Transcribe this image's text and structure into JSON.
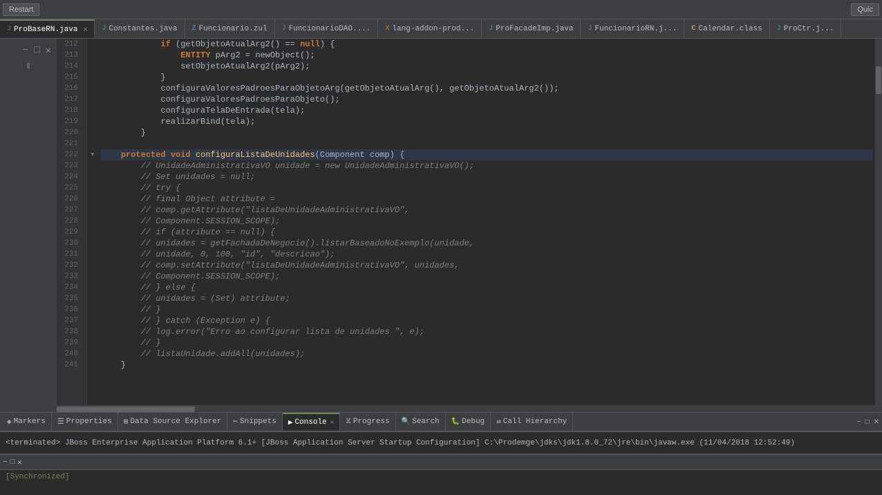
{
  "topbar": {
    "restart_label": "Restart",
    "quick_label": "Quic"
  },
  "tabs": [
    {
      "label": "ProBaseRN.java",
      "icon": "J",
      "type": "java",
      "active": true
    },
    {
      "label": "Constantes.java",
      "icon": "J",
      "type": "java",
      "active": false
    },
    {
      "label": "Funcionario.zul",
      "icon": "Z",
      "type": "zul",
      "active": false
    },
    {
      "label": "FuncionarioDAO....",
      "icon": "J",
      "type": "java",
      "active": false
    },
    {
      "label": "lang-addon-prod...",
      "icon": "X",
      "type": "xml",
      "active": false
    },
    {
      "label": "ProFacadeImp.java",
      "icon": "J",
      "type": "java",
      "active": false
    },
    {
      "label": "FuncionarioRN.j...",
      "icon": "J",
      "type": "java",
      "active": false
    },
    {
      "label": "Calendar.class",
      "icon": "C",
      "type": "class",
      "active": false
    },
    {
      "label": "ProCtr.j...",
      "icon": "J",
      "type": "java",
      "active": false
    }
  ],
  "lines": [
    {
      "num": 212,
      "content": "            if (getObjetoAtualArg2() == null) {",
      "fold": false,
      "highlighted": false
    },
    {
      "num": 213,
      "content": "                ENTITY pArg2 = newObject();",
      "fold": false,
      "highlighted": false
    },
    {
      "num": 214,
      "content": "                setObjetoAtualArg2(pArg2);",
      "fold": false,
      "highlighted": false
    },
    {
      "num": 215,
      "content": "            }",
      "fold": false,
      "highlighted": false
    },
    {
      "num": 216,
      "content": "            configuraValoresPadroesParaObjetoArg(getObjetoAtualArg(), getObjetoAtualArg2());",
      "fold": false,
      "highlighted": false
    },
    {
      "num": 217,
      "content": "            configuraValoresPadroesParaObjeto();",
      "fold": false,
      "highlighted": false
    },
    {
      "num": 218,
      "content": "            configuraTelaDeEntrada(tela);",
      "fold": false,
      "highlighted": false
    },
    {
      "num": 219,
      "content": "            realizarBind(tela);",
      "fold": false,
      "highlighted": false
    },
    {
      "num": 220,
      "content": "        }",
      "fold": false,
      "highlighted": false
    },
    {
      "num": 221,
      "content": "",
      "fold": false,
      "highlighted": false
    },
    {
      "num": 222,
      "content": "    protected void configuraListaDeUnidades(Component comp) {",
      "fold": true,
      "highlighted": true
    },
    {
      "num": 223,
      "content": "        // UnidadeAdministrativaVO unidade = new UnidadeAdministrativaVO();",
      "fold": false,
      "highlighted": false
    },
    {
      "num": 224,
      "content": "        // Set unidades = null;",
      "fold": false,
      "highlighted": false
    },
    {
      "num": 225,
      "content": "        // try {",
      "fold": false,
      "highlighted": false
    },
    {
      "num": 226,
      "content": "        // final Object attribute =",
      "fold": false,
      "highlighted": false
    },
    {
      "num": 227,
      "content": "        // comp.getAttribute(\"listaDeUnidadeAdministrativaVO\",",
      "fold": false,
      "highlighted": false
    },
    {
      "num": 228,
      "content": "        // Component.SESSION_SCOPE);",
      "fold": false,
      "highlighted": false
    },
    {
      "num": 229,
      "content": "        // if (attribute == null) {",
      "fold": false,
      "highlighted": false
    },
    {
      "num": 230,
      "content": "        // unidades = getFachadaDeNegocio().listarBaseadoNoExemplo(unidade,",
      "fold": false,
      "highlighted": false
    },
    {
      "num": 231,
      "content": "        // unidade, 0, 100, \"id\", \"descricao\");",
      "fold": false,
      "highlighted": false
    },
    {
      "num": 232,
      "content": "        // comp.setAttribute(\"listaDeUnidadeAdministrativaVO\", unidades,",
      "fold": false,
      "highlighted": false
    },
    {
      "num": 233,
      "content": "        // Component.SESSION_SCOPE);",
      "fold": false,
      "highlighted": false
    },
    {
      "num": 234,
      "content": "        // } else {",
      "fold": false,
      "highlighted": false
    },
    {
      "num": 235,
      "content": "        // unidades = (Set) attribute;",
      "fold": false,
      "highlighted": false
    },
    {
      "num": 236,
      "content": "        // }",
      "fold": false,
      "highlighted": false
    },
    {
      "num": 237,
      "content": "        // } catch (Exception e) {",
      "fold": false,
      "highlighted": false
    },
    {
      "num": 238,
      "content": "        // log.error(\"Erro ao configurar lista de unidades \", e);",
      "fold": false,
      "highlighted": false
    },
    {
      "num": 239,
      "content": "        // }",
      "fold": false,
      "highlighted": false
    },
    {
      "num": 240,
      "content": "        // listaUnidade.addAll(unidades);",
      "fold": false,
      "highlighted": false
    },
    {
      "num": 241,
      "content": "    }",
      "fold": false,
      "highlighted": false
    }
  ],
  "bottom_tabs": [
    {
      "label": "Markers",
      "icon": "◈",
      "active": false
    },
    {
      "label": "Properties",
      "icon": "☰",
      "active": false
    },
    {
      "label": "Data Source Explorer",
      "icon": "⊞",
      "active": false
    },
    {
      "label": "Snippets",
      "icon": "✂",
      "active": false
    },
    {
      "label": "Console",
      "icon": "▶",
      "active": true
    },
    {
      "label": "Progress",
      "icon": "⧖",
      "active": false
    },
    {
      "label": "Search",
      "icon": "🔍",
      "active": false
    },
    {
      "label": "Debug",
      "icon": "🐛",
      "active": false
    },
    {
      "label": "Call Hierarchy",
      "icon": "⇌",
      "active": false
    }
  ],
  "console_output": "<terminated> JBoss Enterprise Application Platform 6.1+ [JBoss Application Server Startup Configuration] C:\\Prodemge\\jdks\\jdk1.8.0_72\\jre\\bin\\javaw.exe (11/04/2018 12:52:49)",
  "bottom_window": {
    "label1": "Synchronized",
    "label2": "[Synchronized]"
  }
}
